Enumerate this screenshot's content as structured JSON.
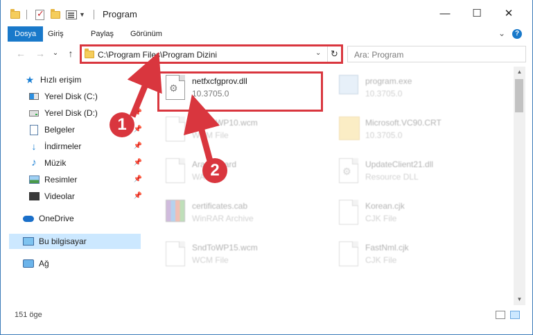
{
  "window": {
    "title": "Program",
    "minimize": "—",
    "maximize": "☐",
    "close": "✕"
  },
  "ribbon": {
    "tabs": [
      {
        "label": "Dosya",
        "active": true
      },
      {
        "label": "Giriş"
      },
      {
        "label": "Paylaş"
      },
      {
        "label": "Görünüm"
      }
    ],
    "expand": "⌄",
    "help": "?"
  },
  "address": {
    "path": "C:\\Program Files\\Program Dizini",
    "dropdown": "⌄",
    "refresh": "↻"
  },
  "search": {
    "placeholder": "Ara: Program"
  },
  "nav": {
    "back": "←",
    "forward": "→",
    "recent": "⌄",
    "up": "↑",
    "items": [
      {
        "label": "Hızlı erişim",
        "icon": "star-icon"
      },
      {
        "label": "Yerel Disk (C:)",
        "icon": "windows-drive-icon"
      },
      {
        "label": "Yerel Disk (D:)",
        "icon": "drive-icon",
        "pinned": true
      },
      {
        "label": "Belgeler",
        "icon": "document-icon",
        "pinned": true
      },
      {
        "label": "İndirmeler",
        "icon": "download-icon",
        "pinned": true
      },
      {
        "label": "Müzik",
        "icon": "music-icon",
        "pinned": true
      },
      {
        "label": "Resimler",
        "icon": "picture-icon",
        "pinned": true
      },
      {
        "label": "Videolar",
        "icon": "video-icon",
        "pinned": true
      },
      {
        "label": "OneDrive",
        "icon": "cloud-icon"
      },
      {
        "label": "Bu bilgisayar",
        "icon": "computer-icon",
        "selected": true
      },
      {
        "label": "Ağ",
        "icon": "network-icon"
      }
    ],
    "pin_glyph": "📌"
  },
  "files": [
    {
      "name": "netfxcfgprov.dll",
      "sub": "10.3705.0",
      "icon": "dll-gear-icon",
      "highlighted": true
    },
    {
      "name": "program.exe",
      "sub": "10.3705.0",
      "icon": "exe-icon"
    },
    {
      "name": "SndToWP10.wcm",
      "sub": "WCM File",
      "icon": "file-icon"
    },
    {
      "name": "Microsoft.VC90.CRT",
      "sub": "10.3705.0",
      "icon": "folder-icon"
    },
    {
      "name": "Ara_Hazard",
      "sub": "WAV File",
      "icon": "file-icon"
    },
    {
      "name": "UpdateClient21.dll",
      "sub": "Resource DLL",
      "icon": "dll-gear-icon"
    },
    {
      "name": "certificates.cab",
      "sub": "WinRAR Archive",
      "icon": "rar-icon"
    },
    {
      "name": "Korean.cjk",
      "sub": "CJK File",
      "icon": "file-icon"
    },
    {
      "name": "SndToWP15.wcm",
      "sub": "WCM File",
      "icon": "file-icon"
    },
    {
      "name": "FastNml.cjk",
      "sub": "CJK File",
      "icon": "file-icon"
    }
  ],
  "callouts": [
    "1",
    "2"
  ],
  "status": {
    "count": "151 öge"
  },
  "colors": {
    "accent": "#1979ca",
    "highlight": "#d9363e",
    "selection": "#cce8ff"
  }
}
